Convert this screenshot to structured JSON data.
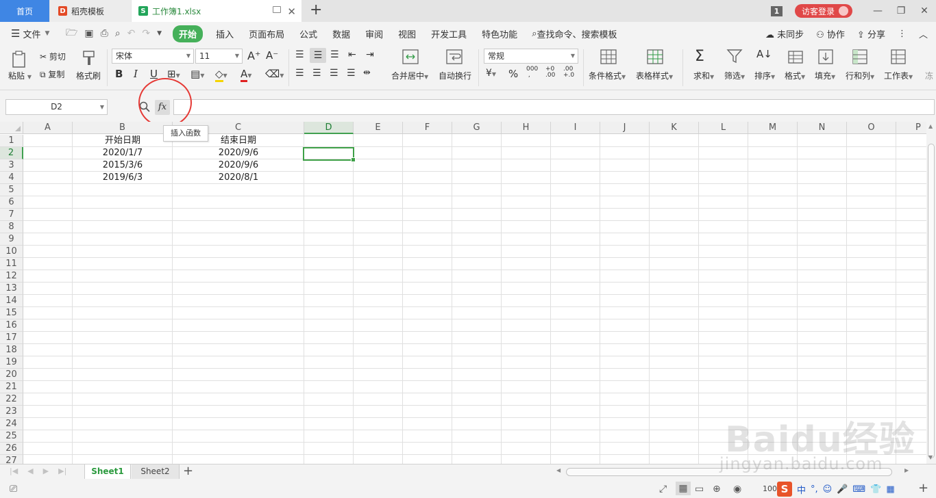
{
  "tabs": {
    "home": "首页",
    "template": "稻壳模板",
    "doc": "工作簿1.xlsx",
    "window_count": "1",
    "login": "访客登录"
  },
  "menu": {
    "file": "文件",
    "items": [
      "开始",
      "插入",
      "页面布局",
      "公式",
      "数据",
      "审阅",
      "视图",
      "开发工具",
      "特色功能"
    ],
    "search": "查找命令、搜索模板",
    "sync": "未同步",
    "collab": "协作",
    "share": "分享"
  },
  "ribbon": {
    "paste": "粘贴",
    "cut": "剪切",
    "copy": "复制",
    "format_painter": "格式刷",
    "font_name": "宋体",
    "font_size": "11",
    "number_format": "常规",
    "merge_center": "合并居中",
    "auto_wrap": "自动换行",
    "cond_format": "条件格式",
    "table_style": "表格样式",
    "sum": "求和",
    "filter": "筛选",
    "sort": "排序",
    "format": "格式",
    "fill": "填充",
    "row_col": "行和列",
    "worksheet": "工作表",
    "overflow": "冻"
  },
  "formula_bar": {
    "name_box": "D2",
    "fx": "fx",
    "tooltip": "插入函数",
    "formula": ""
  },
  "grid": {
    "columns": [
      "A",
      "B",
      "C",
      "D",
      "E",
      "F",
      "G",
      "H",
      "I",
      "J",
      "K",
      "L",
      "M",
      "N",
      "O",
      "P"
    ],
    "rows": [
      "1",
      "2",
      "3",
      "4",
      "5",
      "6",
      "7",
      "8",
      "9",
      "10",
      "11",
      "12",
      "13",
      "14",
      "15",
      "16",
      "17",
      "18",
      "19",
      "20",
      "21",
      "22",
      "23",
      "24",
      "25",
      "26",
      "27"
    ],
    "cells": {
      "B1": "开始日期",
      "C1": "结束日期",
      "B2": "2020/1/7",
      "C2": "2020/9/6",
      "B3": "2015/3/6",
      "C3": "2020/9/6",
      "B4": "2019/6/3",
      "C4": "2020/8/1"
    },
    "selected_cell": "D2"
  },
  "sheets": [
    "Sheet1",
    "Sheet2"
  ],
  "status": {
    "zoom": "100",
    "ime_mode": "中"
  },
  "watermark": {
    "text": "Baidu经验",
    "url": "jingyan.baidu.com"
  },
  "colors": {
    "accent_green": "#45b05a",
    "tab_blue": "#3f86e4",
    "login_red": "#e04848",
    "circle_red": "#e53935"
  }
}
